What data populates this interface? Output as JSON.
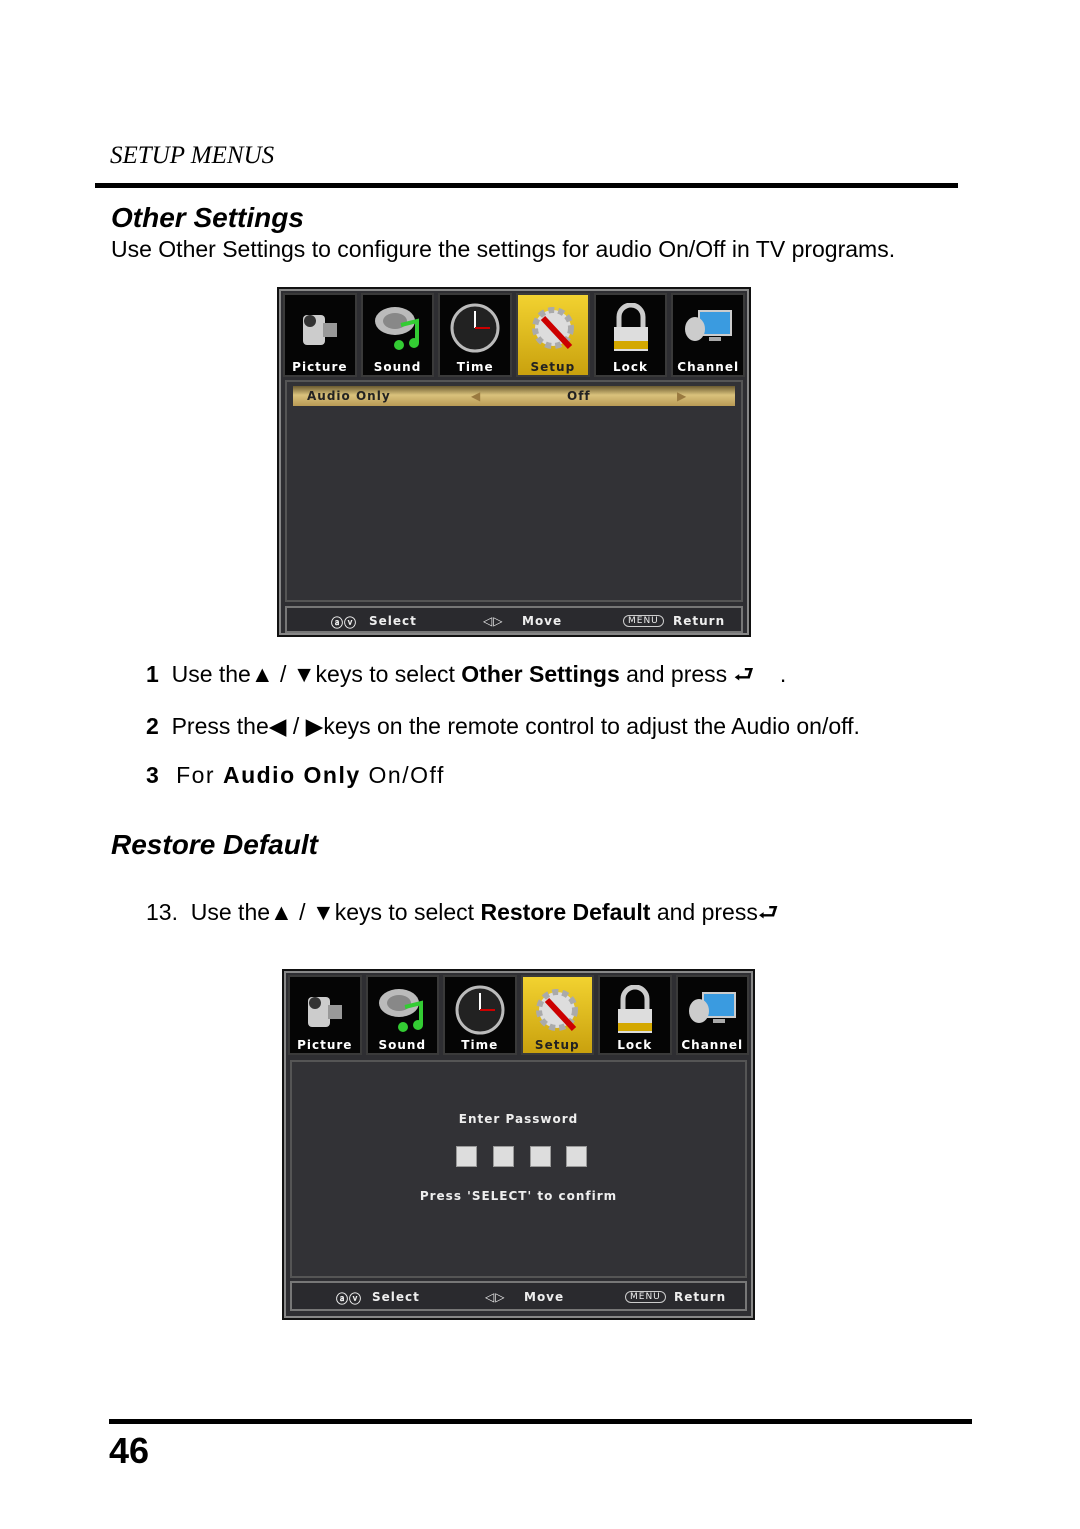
{
  "header": {
    "section": "SETUP MENUS"
  },
  "other_settings": {
    "title": "Other Settings",
    "intro": "Use Other Settings to configure the settings for audio On/Off in TV programs.",
    "steps": [
      {
        "num": "1",
        "pre": "Use the",
        "mid": "keys to select",
        "bold": "Other Settings",
        "post": "and press",
        "end": "."
      },
      {
        "num": "2",
        "pre": "Press the",
        "mid": "keys on the remote control to adjust the Audio on/off."
      },
      {
        "num": "3",
        "pre": "For",
        "bold": "Audio Only",
        "post": "On/Off"
      }
    ]
  },
  "tv_menu": {
    "tabs": [
      {
        "label": "Picture",
        "icon": "camcorder-icon"
      },
      {
        "label": "Sound",
        "icon": "speaker-music-note-icon"
      },
      {
        "label": "Time",
        "icon": "clock-icon"
      },
      {
        "label": "Setup",
        "icon": "gear-screwdriver-icon",
        "active": true
      },
      {
        "label": "Lock",
        "icon": "padlock-icon"
      },
      {
        "label": "Channel",
        "icon": "satellite-monitor-icon"
      }
    ],
    "footer": {
      "select": "Select",
      "move": "Move",
      "menu_key": "MENU",
      "return": "Return"
    }
  },
  "screen1": {
    "row_label": "Audio Only",
    "row_value": "Off"
  },
  "restore_default": {
    "title": "Restore Default",
    "step": {
      "num": "13.",
      "pre": "Use the",
      "mid": "keys to select",
      "bold": "Restore Default",
      "post": "and press"
    }
  },
  "screen2": {
    "prompt": "Enter Password",
    "confirm": "Press 'SELECT' to confirm",
    "slots": 4
  },
  "footer": {
    "page_number": "46"
  }
}
